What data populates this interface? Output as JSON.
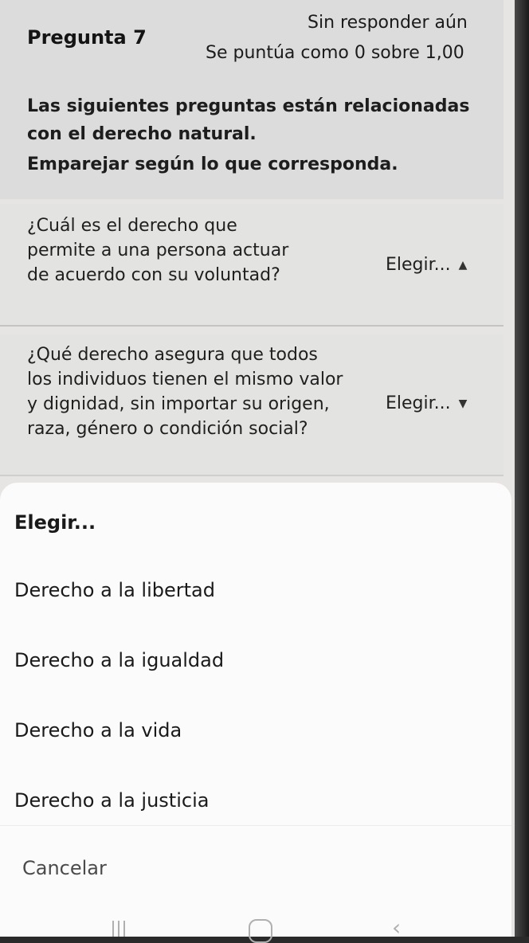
{
  "question": {
    "status": "Sin responder aún",
    "title": "Pregunta 7",
    "grade": "Se puntúa como 0 sobre 1,00",
    "intro": "Las siguientes preguntas están relacionadas con el derecho natural.",
    "instructions": "Emparejar según lo que corresponda."
  },
  "matches": [
    {
      "stem": "¿Cuál es el derecho que permite a una persona actuar de acuerdo con su voluntad?",
      "selected": "Elegir...",
      "caret_icon": "caret-up-icon"
    },
    {
      "stem": "¿Qué derecho asegura que todos los individuos tienen el mismo valor y dignidad, sin importar su origen, raza, género o condición social?",
      "selected": "Elegir...",
      "caret_icon": "caret-down-icon"
    }
  ],
  "sheet": {
    "header": "Elegir...",
    "options": [
      "Derecho a la libertad",
      "Derecho a la igualdad",
      "Derecho a la vida",
      "Derecho a la justicia"
    ],
    "cancel": "Cancelar"
  },
  "navbar": {
    "recent_icon": "recent-apps-icon",
    "home_icon": "home-icon",
    "back_icon": "back-icon"
  }
}
